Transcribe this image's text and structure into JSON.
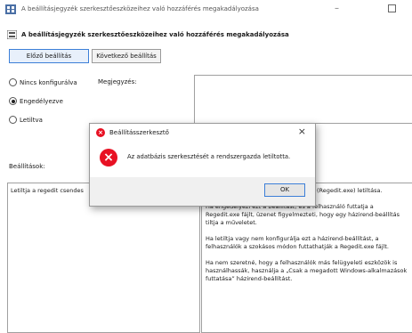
{
  "window": {
    "title": "A beállításjegyzék szerkesztőeszközeihez való hozzáférés megakadályozása",
    "heading": "A beállításjegyzék szerkesztőeszközeihez való hozzáférés megakadályozása"
  },
  "nav": {
    "prev_label": "Előző beállítás",
    "next_label": "Következő beállítás"
  },
  "options": [
    {
      "label": "Nincs konfigurálva",
      "checked": false
    },
    {
      "label": "Engedélyezve",
      "checked": true
    },
    {
      "label": "Letiltva",
      "checked": false
    }
  ],
  "comment_label": "Megjegyzés:",
  "options_label": "Beállítások:",
  "left_panel_text": "Letiltja a regedit csendes",
  "help_paragraphs": [
    "Letiltja a beállításjegyzék-szerkesztők (Regedit.exe) letiltása.",
    "Ha engedélyezi ezt a beállítást, és a felhasználó futtatja a Regedit.exe fájlt, üzenet figyelmezteti, hogy egy házirend-beállítás tiltja a műveletet.",
    "Ha letiltja vagy nem konfigurálja ezt a házirend-beállítást, a felhasználók a szokásos módon futtathatják a Regedit.exe fájlt.",
    "Ha nem szeretné, hogy a felhasználók más felügyeleti eszközök is használhassák, használja a „Csak a megadott Windows-alkalmazások futtatása” házirend-beállítást."
  ],
  "dialog": {
    "title": "Beállításszerkesztő",
    "message": "Az adatbázis szerkesztését a rendszergazda letiltotta.",
    "ok_label": "OK",
    "close_symbol": "×"
  },
  "colors": {
    "error_red": "#e81123",
    "accent_blue": "#3c7fd8"
  }
}
